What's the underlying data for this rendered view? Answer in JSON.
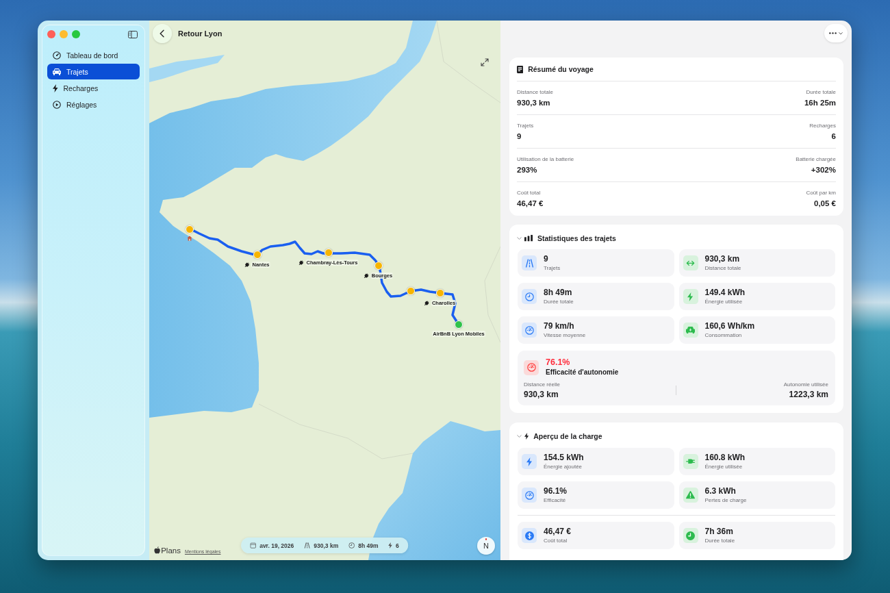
{
  "sidebar": {
    "items": [
      {
        "label": "Tableau de bord",
        "selected": false
      },
      {
        "label": "Trajets",
        "selected": true
      },
      {
        "label": "Recharges",
        "selected": false
      },
      {
        "label": "Réglages",
        "selected": false
      }
    ]
  },
  "map": {
    "title": "Retour Lyon",
    "stops": [
      {
        "kind": "start"
      },
      {
        "kind": "charger",
        "label": "Nantes"
      },
      {
        "kind": "charger",
        "label": "Chambray-Lès-Tours"
      },
      {
        "kind": "charger",
        "label": "Bourges"
      },
      {
        "kind": "waypoint"
      },
      {
        "kind": "charger",
        "label": "Charolles"
      },
      {
        "kind": "end",
        "label": "AirBnB Lyon Mobiles"
      }
    ],
    "trip_pill": {
      "date": "avr. 19, 2026",
      "distance": "930,3 km",
      "duration": "8h 49m",
      "charges": "6"
    },
    "attribution": {
      "logo": "Plans",
      "legal_link": "Mentions légales"
    },
    "compass": {
      "label": "N"
    }
  },
  "summary": {
    "title": "Résumé du voyage",
    "rows": [
      {
        "left": {
          "label": "Distance totale",
          "value": "930,3 km"
        },
        "right": {
          "label": "Durée totale",
          "value": "16h 25m"
        }
      },
      {
        "left": {
          "label": "Trajets",
          "value": "9"
        },
        "right": {
          "label": "Recharges",
          "value": "6"
        }
      },
      {
        "left": {
          "label": "Utilisation de la batterie",
          "value": "293%"
        },
        "right": {
          "label": "Batterie chargée",
          "value": "+302%"
        }
      },
      {
        "left": {
          "label": "Coût total",
          "value": "46,47 €"
        },
        "right": {
          "label": "Coût par km",
          "value": "0,05 €"
        }
      }
    ]
  },
  "trip_stats": {
    "title": "Statistiques des trajets",
    "expanded": true,
    "tiles": [
      {
        "value": "9",
        "label": "Trajets"
      },
      {
        "value": "930,3 km",
        "label": "Distance totale"
      },
      {
        "value": "8h 49m",
        "label": "Durée totale"
      },
      {
        "value": "149.4 kWh",
        "label": "Énergie utilisée"
      },
      {
        "value": "79 km/h",
        "label": "Vitesse moyenne"
      },
      {
        "value": "160,6 Wh/km",
        "label": "Consommation"
      }
    ],
    "efficiency": {
      "value": "76.1%",
      "title": "Efficacité d'autonomie",
      "left": {
        "label": "Distance réelle",
        "value": "930,3 km"
      },
      "right": {
        "label": "Autonomie utilisée",
        "value": "1223,3 km"
      }
    }
  },
  "charge_overview": {
    "title": "Aperçu de la charge",
    "expanded": true,
    "tile_groups": [
      {
        "tiles": [
          {
            "value": "154.5 kWh",
            "label": "Énergie ajoutée"
          },
          {
            "value": "160.8 kWh",
            "label": "Énergie utilisée"
          },
          {
            "value": "96.1%",
            "label": "Efficacité"
          },
          {
            "value": "6.3 kWh",
            "label": "Pertes de charge"
          }
        ]
      },
      {
        "tiles": [
          {
            "value": "46,47 €",
            "label": "Coût total"
          },
          {
            "value": "7h 36m",
            "label": "Durée totale"
          }
        ]
      }
    ]
  }
}
